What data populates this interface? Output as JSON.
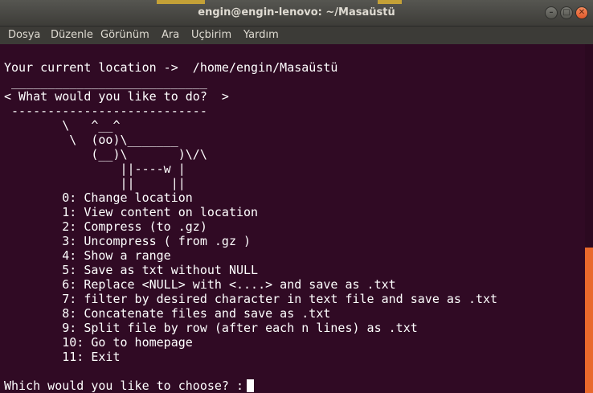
{
  "window": {
    "title": "engin@engin-lenovo: ~/Masaüstü",
    "buttons": {
      "minimize": "–",
      "maximize": "□",
      "close": "✕"
    }
  },
  "menu": [
    "Dosya",
    "Düzenle",
    "Görünüm",
    "Ara",
    "Uçbirim",
    "Yardım"
  ],
  "terminal": {
    "lines": [
      "Your current location ->  /home/engin/Masaüstü",
      " ___________________________",
      "< What would you like to do?  >",
      " ---------------------------",
      "        \\   ^__^",
      "         \\  (oo)\\_______",
      "            (__)\\       )\\/\\",
      "                ||----w |",
      "                ||     ||",
      "        0: Change location",
      "        1: View content on location",
      "        2: Compress (to .gz)",
      "        3: Uncompress ( from .gz )",
      "        4: Show a range",
      "        5: Save as txt without NULL",
      "        6: Replace <NULL> with <....> and save as .txt",
      "        7: filter by desired character in text file and save as .txt",
      "        8: Concatenate files and save as .txt",
      "        9: Split file by row (after each n lines) as .txt",
      "        10: Go to homepage",
      "        11: Exit",
      ""
    ],
    "prompt": "Which would you like to choose? :"
  },
  "colors": {
    "terminal_bg": "#300a24",
    "text": "#ffffff",
    "scroll_thumb": "#e9692c",
    "close_button": "#e0582a"
  }
}
